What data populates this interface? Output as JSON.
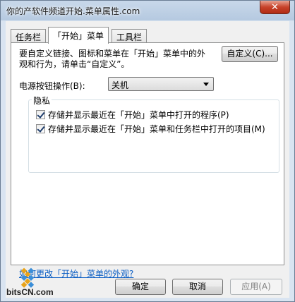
{
  "window": {
    "title": "你的产软件频道开始.菜单属性.com",
    "close_label": "✕"
  },
  "tabs": [
    {
      "label": "任务栏"
    },
    {
      "label": "「开始」菜单"
    },
    {
      "label": "工具栏"
    }
  ],
  "panel": {
    "description": "要自定义链接、图标和菜单在「开始」菜单中的外观和行为，请单击“自定义”。",
    "customize_button": "自定义(C)...",
    "power_label": "电源按钮操作(B):",
    "power_value": "关机",
    "privacy_group": "隐私",
    "checkboxes": [
      {
        "label": "存储并显示最近在「开始」菜单中打开的程序(P)",
        "checked": true
      },
      {
        "label": "存储并显示最近在「开始」菜单和任务栏中打开的项目(M)",
        "checked": true
      }
    ]
  },
  "link_text": "如何更改「开始」菜单的外观?",
  "buttons": {
    "ok": "确定",
    "cancel": "取消",
    "apply": "应用(A)"
  },
  "watermark": "bitsCN.com"
}
